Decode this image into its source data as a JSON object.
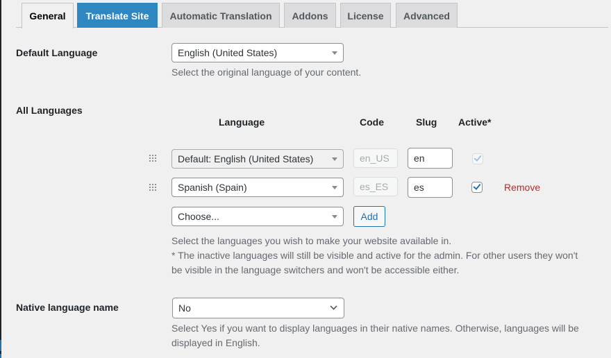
{
  "tabs": [
    {
      "label": "General",
      "state": "active"
    },
    {
      "label": "Translate Site",
      "state": "highlight"
    },
    {
      "label": "Automatic Translation",
      "state": "normal"
    },
    {
      "label": "Addons",
      "state": "normal"
    },
    {
      "label": "License",
      "state": "normal"
    },
    {
      "label": "Advanced",
      "state": "normal"
    }
  ],
  "default_language": {
    "label": "Default Language",
    "value": "English (United States)",
    "description": "Select the original language of your content."
  },
  "all_languages": {
    "label": "All Languages",
    "columns": {
      "language": "Language",
      "code": "Code",
      "slug": "Slug",
      "active": "Active*"
    },
    "rows": [
      {
        "language": "Default: English (United States)",
        "code": "en_US",
        "slug": "en",
        "active": true,
        "disabled": true,
        "remove_label": ""
      },
      {
        "language": "Spanish (Spain)",
        "code": "es_ES",
        "slug": "es",
        "active": true,
        "disabled": false,
        "remove_label": "Remove"
      }
    ],
    "choose_placeholder": "Choose...",
    "add_label": "Add",
    "description_line1": "Select the languages you wish to make your website available in.",
    "description_line2": "* The inactive languages will still be visible and active for the admin. For other users they won't",
    "description_line3": "be visible in the language switchers and won't be accessible either."
  },
  "native_language_name": {
    "label": "Native language name",
    "value": "No",
    "description_line1": "Select Yes if you want to display languages in their native names. Otherwise, languages will be",
    "description_line2": "displayed in English."
  },
  "colors": {
    "accent": "#2271b1",
    "highlight_tab": "#2e87c0",
    "remove": "#b32d2e",
    "background": "#f0f0f1"
  }
}
